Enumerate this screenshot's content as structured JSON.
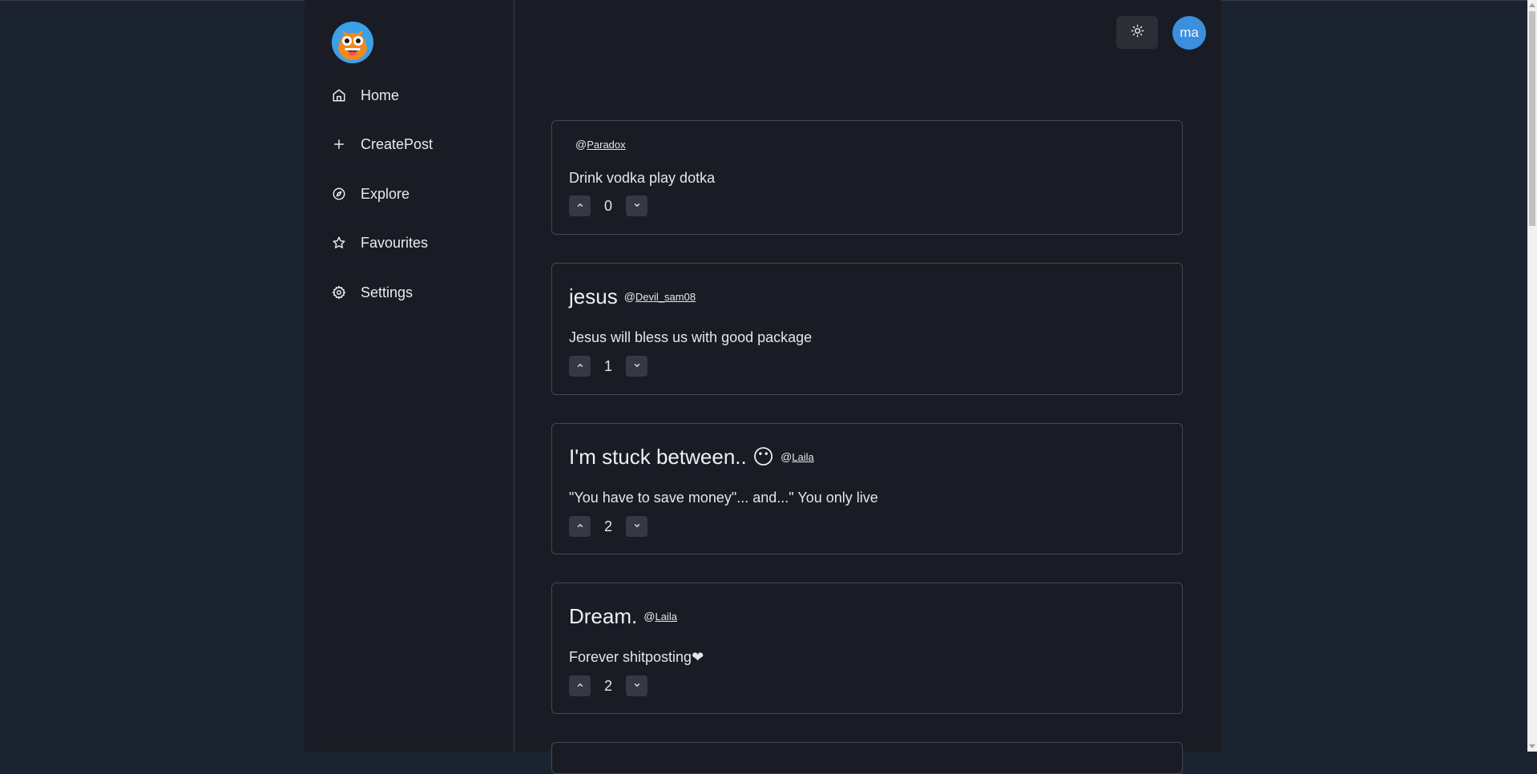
{
  "sidebar": {
    "logo_icon": "emoji-face-logo-icon",
    "items": [
      {
        "label": "Home",
        "icon": "home-icon"
      },
      {
        "label": "CreatePost",
        "icon": "plus-icon"
      },
      {
        "label": "Explore",
        "icon": "compass-icon"
      },
      {
        "label": "Favourites",
        "icon": "star-icon"
      },
      {
        "label": "Settings",
        "icon": "gear-icon"
      }
    ]
  },
  "header": {
    "theme_icon": "sun-icon",
    "avatar_initials": "ma"
  },
  "posts": [
    {
      "title": "",
      "user": "Paradox",
      "body": "Drink vodka play dotka",
      "votes": "0"
    },
    {
      "title": "jesus",
      "user": "Devil_sam08",
      "body": "Jesus will bless us with good package",
      "votes": "1"
    },
    {
      "title": "I'm stuck between.. 😶",
      "user": "Laila",
      "body": "\"You have to save money\"... and...\" You only live",
      "votes": "2"
    },
    {
      "title": "Dream.",
      "user": "Laila",
      "body": "Forever shitposting❤",
      "votes": "2"
    }
  ],
  "colors": {
    "background": "#1b2230",
    "panel": "#191c24",
    "accent": "#3b8fde"
  }
}
